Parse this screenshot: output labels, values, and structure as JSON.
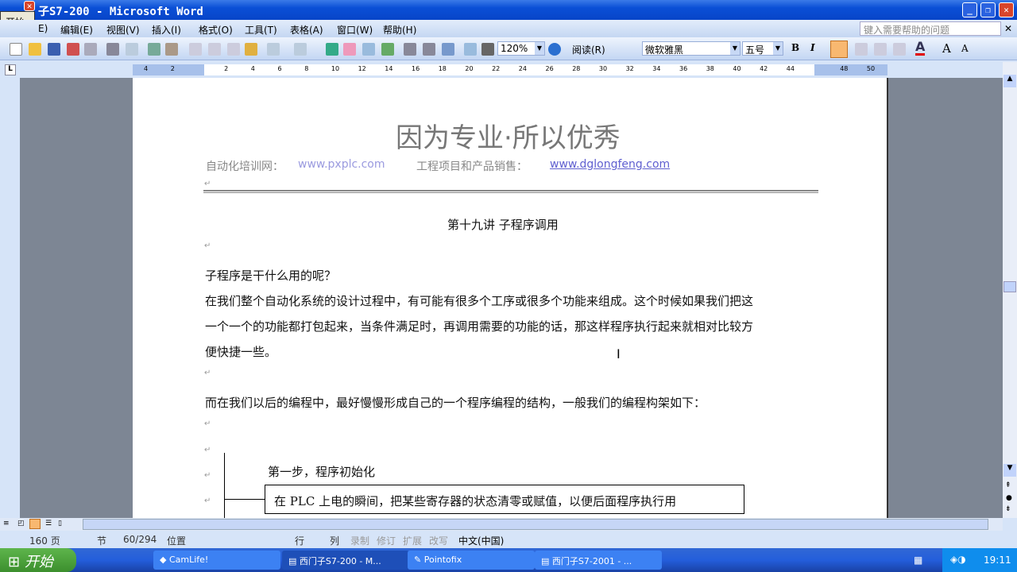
{
  "window": {
    "title": "子S7-200 - Microsoft Word",
    "start_popup": "开始"
  },
  "menu": [
    "编辑(E)",
    "视图(V)",
    "插入(I)",
    "格式(O)",
    "工具(T)",
    "表格(A)",
    "窗口(W)",
    "帮助(H)"
  ],
  "menu_partial": "E)",
  "help_box": {
    "placeholder": "键入需要帮助的问题"
  },
  "toolbar": {
    "zoom": "120%",
    "read_label": "阅读(R)",
    "font": "微软雅黑",
    "size": "五号",
    "bold": "B",
    "italic": "I",
    "font_color": "#e00000"
  },
  "ruler": {
    "ticks": [
      "4",
      "2",
      "",
      "2",
      "4",
      "6",
      "8",
      "10",
      "12",
      "14",
      "16",
      "18",
      "20",
      "22",
      "24",
      "26",
      "28",
      "30",
      "32",
      "34",
      "36",
      "38",
      "40",
      "42",
      "44",
      "",
      "48",
      "50"
    ]
  },
  "document": {
    "header_title": "因为专业·所以优秀",
    "header_left_label": "自动化培训网：",
    "header_left_link": "www.pxplc.com",
    "header_right_label": "工程项目和产品销售：",
    "header_right_link": "www.dglongfeng.com",
    "heading": "第十九讲 子程序调用",
    "question": "子程序是干什么用的呢？",
    "para1_l1": "在我们整个自动化系统的设计过程中，有可能有很多个工序或很多个功能来组成。这个时候如果我们把这",
    "para1_l2": "一个一个的功能都打包起来，当条件满足时，再调用需要的功能的话，那这样程序执行起来就相对比较方",
    "para1_l3": "便快捷一些。",
    "para2": "而在我们以后的编程中，最好慢慢形成自己的一个程序编程的结构，一般我们的编程构架如下：",
    "step1": "第一步，程序初始化",
    "step1_box": "在 PLC 上电的瞬间，把某些寄存器的状态清零或赋值，以便后面程序执行用"
  },
  "status": {
    "page": "160 页",
    "section": "节",
    "pages": "60/294",
    "position": "位置",
    "line": "行",
    "col": "列",
    "rec": "录制",
    "rev": "修订",
    "ext": "扩展",
    "ovr": "改写",
    "lang": "中文(中国)"
  },
  "taskbar": {
    "start": "开始",
    "tasks": [
      "CamLife!",
      "西门子S7-200 - M...",
      "Pointofix",
      "西门子S7-2001 - ..."
    ],
    "clock": "19:11"
  }
}
